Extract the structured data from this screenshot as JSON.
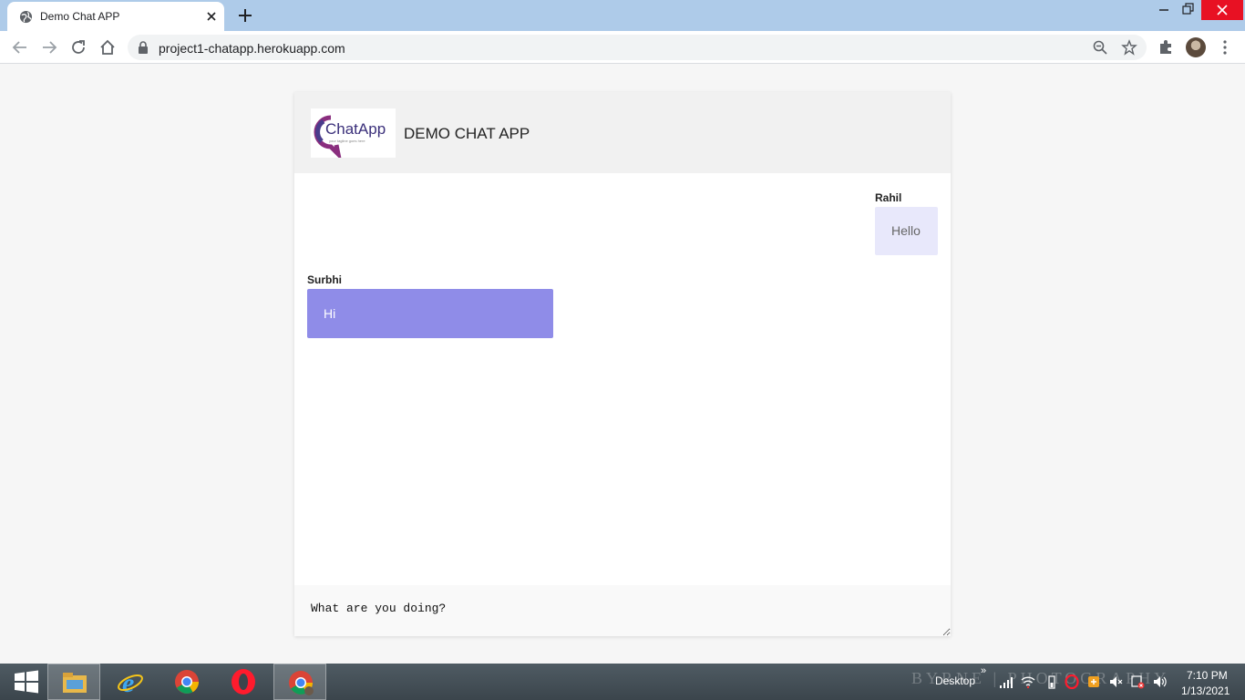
{
  "browser": {
    "tab_title": "Demo Chat APP",
    "url": "project1-chatapp.herokuapp.com"
  },
  "app": {
    "title": "DEMO CHAT APP",
    "logo_text": "ChatApp",
    "logo_tagline": "your tagline goes here"
  },
  "messages": [
    {
      "sender": "Rahil",
      "text": "Hello",
      "side": "right"
    },
    {
      "sender": "Surbhi",
      "text": "Hi",
      "side": "left"
    }
  ],
  "composer": {
    "value": "What are you doing?"
  },
  "colors": {
    "own_bubble": "#e8e8fb",
    "other_bubble": "#8f8ce8",
    "header_bg": "#f1f1f1",
    "tabbar": "#aecbe9"
  },
  "taskbar": {
    "watermark": "BYRNE | PHOTOGRAPHY",
    "desktop_label": "Desktop",
    "time": "7:10 PM",
    "date": "1/13/2021",
    "pinned": [
      "start-icon",
      "file-explorer-icon",
      "internet-explorer-icon",
      "chrome-icon",
      "opera-icon",
      "chrome-active-icon"
    ]
  }
}
